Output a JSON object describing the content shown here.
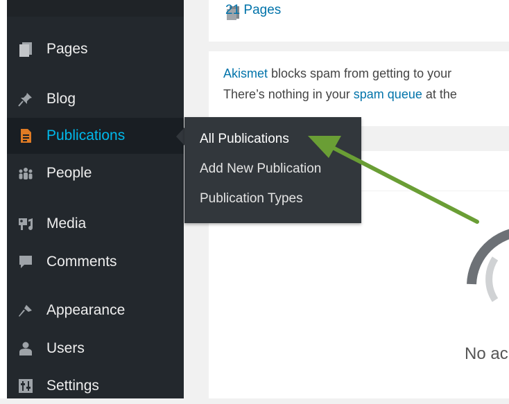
{
  "sidebar": {
    "items": [
      {
        "label": "Pages",
        "icon": "pages-icon"
      },
      {
        "label": "Blog",
        "icon": "pin-icon"
      },
      {
        "label": "Publications",
        "icon": "document-icon"
      },
      {
        "label": "People",
        "icon": "people-icon"
      },
      {
        "label": "Media",
        "icon": "media-icon"
      },
      {
        "label": "Comments",
        "icon": "comment-icon"
      },
      {
        "label": "Appearance",
        "icon": "brush-icon"
      },
      {
        "label": "Users",
        "icon": "user-icon"
      },
      {
        "label": "Settings",
        "icon": "settings-icon"
      }
    ],
    "active_item": "Publications"
  },
  "flyout": {
    "items": [
      "All Publications",
      "Add New Publication",
      "Publication Types"
    ],
    "current": "All Publications"
  },
  "dashboard": {
    "pages_count": "21 Pages",
    "akismet_link": "Akismet",
    "akismet_text": " blocks spam from getting to your",
    "spam_prefix": "There’s nothing in your ",
    "spam_link": "spam queue",
    "spam_suffix": " at the",
    "no_activity": "No ac"
  },
  "colors": {
    "sidebar_bg": "#23282d",
    "active_text": "#00b9eb",
    "flyout_bg": "#32373c",
    "link": "#0073aa",
    "annotation_arrow": "#6a9e35",
    "publications_icon": "#e07b24"
  }
}
